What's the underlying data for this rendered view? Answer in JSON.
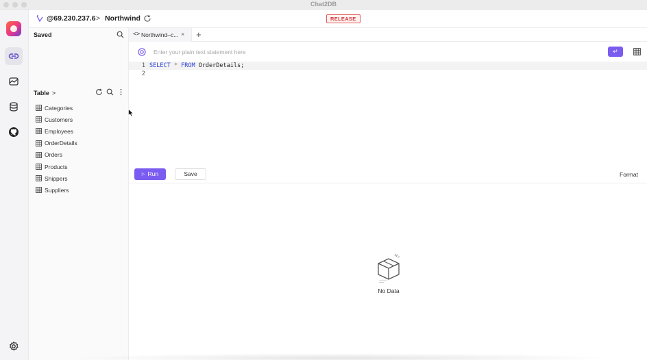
{
  "window": {
    "title": "Chat2DB"
  },
  "connection": {
    "host": "@69.230.237.6",
    "separator": ">",
    "database": "Northwind",
    "badge": "RELEASE"
  },
  "rail": {
    "items": [
      {
        "icon": "connections-icon",
        "active": true
      },
      {
        "icon": "dashboard-icon",
        "active": false
      },
      {
        "icon": "database-icon",
        "active": false
      },
      {
        "icon": "github-icon",
        "active": false
      }
    ],
    "bottom_icon": "settings-icon"
  },
  "sidebar": {
    "saved_label": "Saved",
    "table_label": "Table",
    "table_chevron": ">",
    "tables": [
      "Categories",
      "Customers",
      "Employees",
      "OrderDetails",
      "Orders",
      "Products",
      "Shippers",
      "Suppliers"
    ]
  },
  "tabs": [
    {
      "icon": "<>",
      "label": "Northwind–c...",
      "close": "×"
    }
  ],
  "add_tab": "+",
  "prompt": {
    "placeholder": "Enter your plain text statement here",
    "enter_glyph": "↵"
  },
  "editor": {
    "lines": [
      {
        "num": "1",
        "tokens": [
          {
            "t": "SELECT",
            "k": "kw"
          },
          {
            "t": " "
          },
          {
            "t": "*",
            "k": "op"
          },
          {
            "t": " "
          },
          {
            "t": "FROM",
            "k": "kw"
          },
          {
            "t": " OrderDetails;"
          }
        ]
      },
      {
        "num": "2",
        "tokens": []
      }
    ]
  },
  "actions": {
    "run": "Run",
    "run_glyph": "▷",
    "save": "Save",
    "format": "Format"
  },
  "results": {
    "empty_text": "No Data"
  },
  "colors": {
    "accent": "#7b5cf0",
    "badge": "#cf3a3a"
  }
}
